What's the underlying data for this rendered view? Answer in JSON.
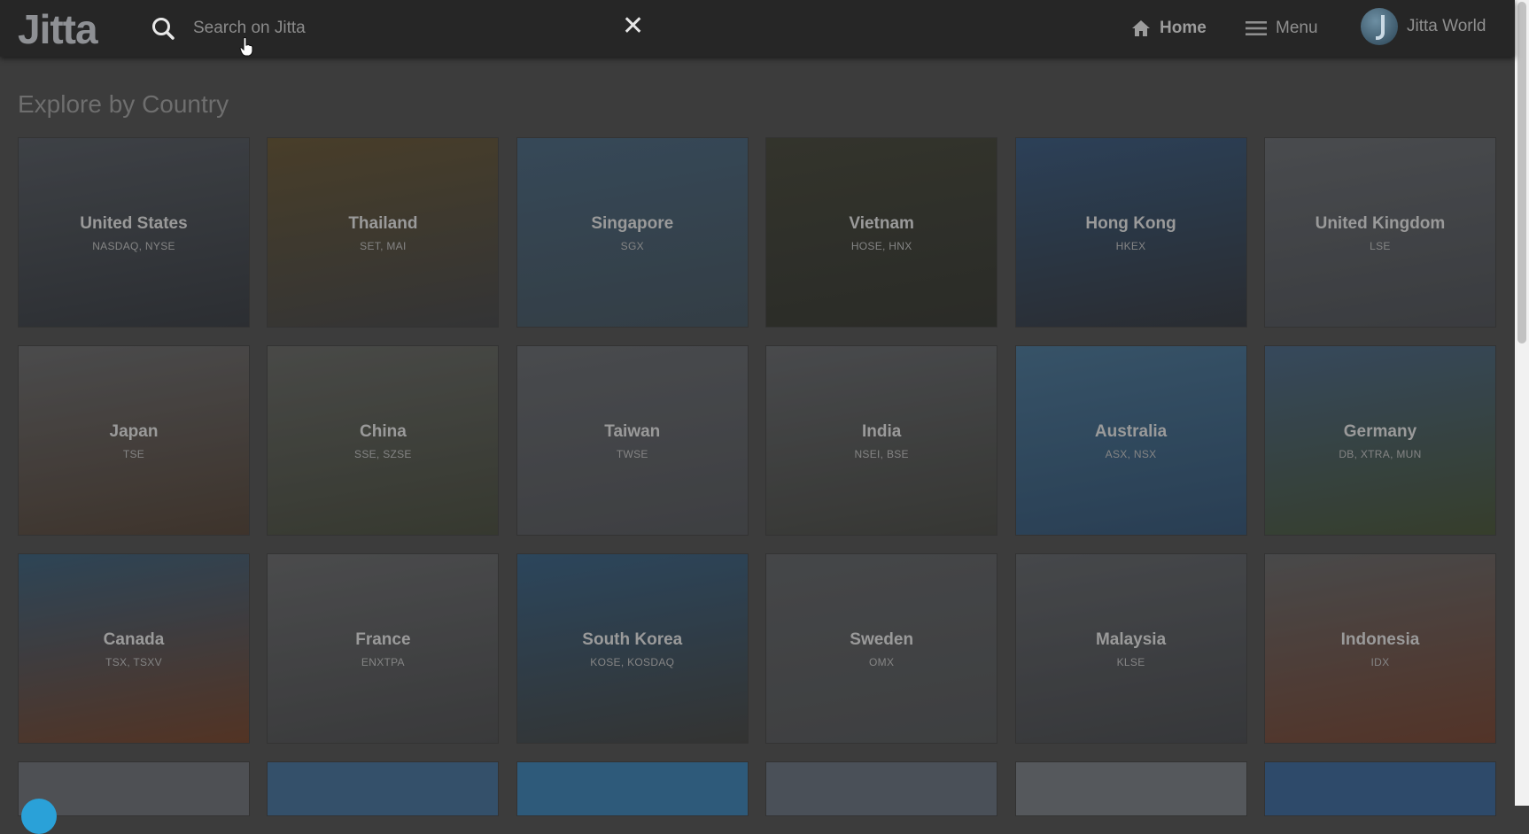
{
  "header": {
    "logo_text": "Jitta",
    "search": {
      "placeholder": "Search on Jitta",
      "value": ""
    },
    "clear_label": "✕",
    "nav": {
      "home_label": "Home",
      "menu_label": "Menu",
      "user_label": "Jitta World"
    }
  },
  "section": {
    "title": "Explore by Country"
  },
  "countries": [
    {
      "name": "United States",
      "exchanges": "NASDAQ, NYSE",
      "colors": [
        "#4a4f56",
        "#2e3238"
      ]
    },
    {
      "name": "Thailand",
      "exchanges": "SET, MAI",
      "colors": [
        "#5a4a2a",
        "#3a3b3d"
      ]
    },
    {
      "name": "Singapore",
      "exchanges": "SGX",
      "colors": [
        "#3e5a72",
        "#3a4a55"
      ]
    },
    {
      "name": "Vietnam",
      "exchanges": "HOSE, HNX",
      "colors": [
        "#3a3b2e",
        "#2c2e28"
      ]
    },
    {
      "name": "Hong Kong",
      "exchanges": "HKEX",
      "colors": [
        "#2e4e72",
        "#2a2f36"
      ]
    },
    {
      "name": "United Kingdom",
      "exchanges": "LSE",
      "colors": [
        "#5b5e63",
        "#44474c"
      ]
    },
    {
      "name": "Japan",
      "exchanges": "TSE",
      "colors": [
        "#5d5e60",
        "#4a3a2e"
      ]
    },
    {
      "name": "China",
      "exchanges": "SSE, SZSE",
      "colors": [
        "#5a5b58",
        "#3e4234"
      ]
    },
    {
      "name": "Taiwan",
      "exchanges": "TWSE",
      "colors": [
        "#5a5d62",
        "#4a4c50"
      ]
    },
    {
      "name": "India",
      "exchanges": "NSEI, BSE",
      "colors": [
        "#5a5c60",
        "#3e3f3a"
      ]
    },
    {
      "name": "Australia",
      "exchanges": "ASX, NSX",
      "colors": [
        "#3f6a8a",
        "#2a4a6a"
      ]
    },
    {
      "name": "Germany",
      "exchanges": "DB, XTRA, MUN",
      "colors": [
        "#3e5a78",
        "#3e4a2e"
      ]
    },
    {
      "name": "Canada",
      "exchanges": "TSX, TSXV",
      "colors": [
        "#30546f",
        "#6a3a22"
      ]
    },
    {
      "name": "France",
      "exchanges": "ENXTPA",
      "colors": [
        "#5d5e60",
        "#434446"
      ]
    },
    {
      "name": "South Korea",
      "exchanges": "KOSE, KOSDAQ",
      "colors": [
        "#2e5678",
        "#3a3a38"
      ]
    },
    {
      "name": "Sweden",
      "exchanges": "OMX",
      "colors": [
        "#55575a",
        "#4a4c4e"
      ]
    },
    {
      "name": "Malaysia",
      "exchanges": "KLSE",
      "colors": [
        "#56595d",
        "#3e4044"
      ]
    },
    {
      "name": "Indonesia",
      "exchanges": "IDX",
      "colors": [
        "#5a5b5c",
        "#6a3a28"
      ]
    }
  ],
  "next_row_colors": [
    "#4e5054",
    "#34506a",
    "#2e5a7a",
    "#4a5058",
    "#55585c",
    "#2e4a6a"
  ]
}
